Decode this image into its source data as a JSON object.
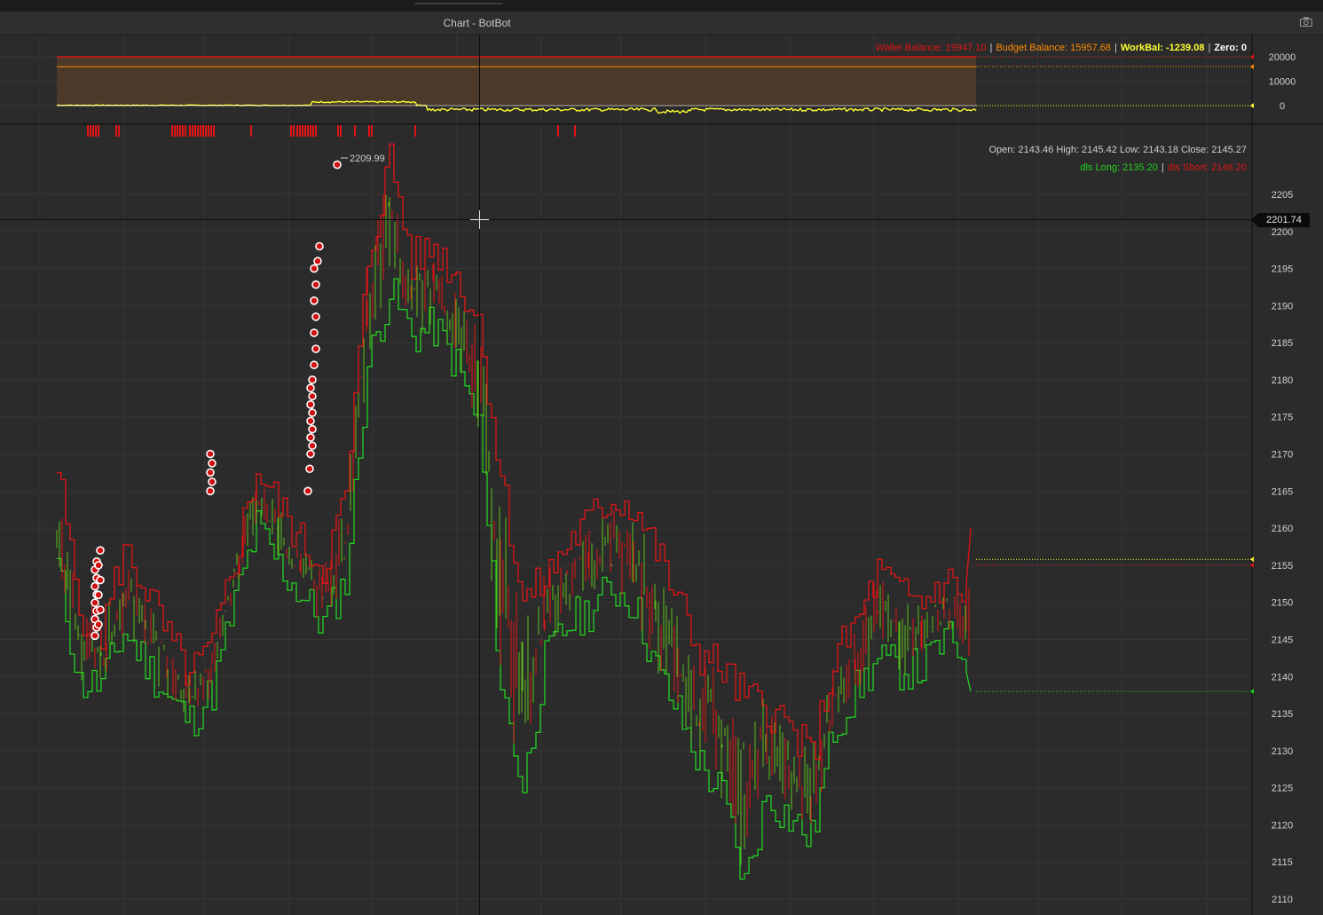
{
  "window": {
    "title": "Chart - BotBot",
    "camera_icon": "camera-icon"
  },
  "colors": {
    "background": "#2b2b2b",
    "grid": "#353535",
    "long": "#22d022",
    "short": "#e01414",
    "wallet": "#e01414",
    "budget": "#ff8c00",
    "work": "#ffff32",
    "zero": "#ffffff"
  },
  "balances": {
    "wallet_label": "Wallet Balance: 19947.10",
    "budget_label": "Budget Balance: 15957.68",
    "work_label": "WorkBal: -1239.08",
    "zero_label": "Zero: 0",
    "separator": "|"
  },
  "ohlc": {
    "text": "Open: 2143.46 High: 2145.42 Low: 2143.18 Close: 2145.27"
  },
  "dls": {
    "long_label": "dls Long: 2135.20",
    "short_label": "dls Short: 2146.20"
  },
  "crosshair": {
    "price_label": "2201.74"
  },
  "chart_data": [
    {
      "type": "line",
      "title": "",
      "ylim": [
        -3000,
        24000
      ],
      "yticks": [
        0,
        10000,
        20000
      ],
      "series": [
        {
          "name": "Wallet Balance",
          "value": 19947.1
        },
        {
          "name": "Budget Balance",
          "value": 15957.68
        },
        {
          "name": "WorkBal",
          "value": -1239.08
        },
        {
          "name": "Zero",
          "value": 0
        }
      ]
    },
    {
      "type": "line",
      "title": "",
      "ylim": [
        2108,
        2215
      ],
      "yticks": [
        2110,
        2115,
        2120,
        2125,
        2130,
        2135,
        2140,
        2145,
        2150,
        2155,
        2160,
        2165,
        2170,
        2175,
        2180,
        2185,
        2190,
        2195,
        2200,
        2205
      ],
      "high_annotation": "2209.99",
      "x": [
        0,
        25,
        50,
        75,
        100,
        125,
        150,
        175,
        200,
        225,
        250,
        275,
        300,
        325,
        350,
        375,
        400,
        425,
        450,
        475,
        500,
        525,
        550,
        575,
        600,
        625,
        650,
        675,
        700,
        725,
        750,
        775,
        800,
        825,
        850,
        875,
        900,
        925,
        950,
        975,
        1000,
        1025,
        1030
      ],
      "series": [
        {
          "name": "dls Short",
          "values": [
            2168,
            2149,
            2146,
            2157,
            2152,
            2145,
            2140,
            2144,
            2156,
            2168,
            2163,
            2158,
            2155,
            2164,
            2196,
            2210,
            2196,
            2198,
            2194,
            2188,
            2167,
            2150,
            2153,
            2158,
            2161,
            2164,
            2163,
            2157,
            2150,
            2143,
            2141,
            2137,
            2136,
            2133,
            2129,
            2142,
            2147,
            2154,
            2151,
            2150,
            2153,
            2151,
            2160
          ]
        },
        {
          "name": "dls Long",
          "values": [
            2155,
            2139,
            2139,
            2146,
            2142,
            2137,
            2134,
            2138,
            2150,
            2160,
            2155,
            2151,
            2147,
            2153,
            2182,
            2192,
            2186,
            2187,
            2182,
            2174,
            2139,
            2125,
            2142,
            2147,
            2149,
            2152,
            2150,
            2141,
            2135,
            2128,
            2124,
            2112,
            2124,
            2121,
            2118,
            2133,
            2138,
            2142,
            2141,
            2141,
            2145,
            2143,
            2138
          ]
        }
      ]
    }
  ]
}
